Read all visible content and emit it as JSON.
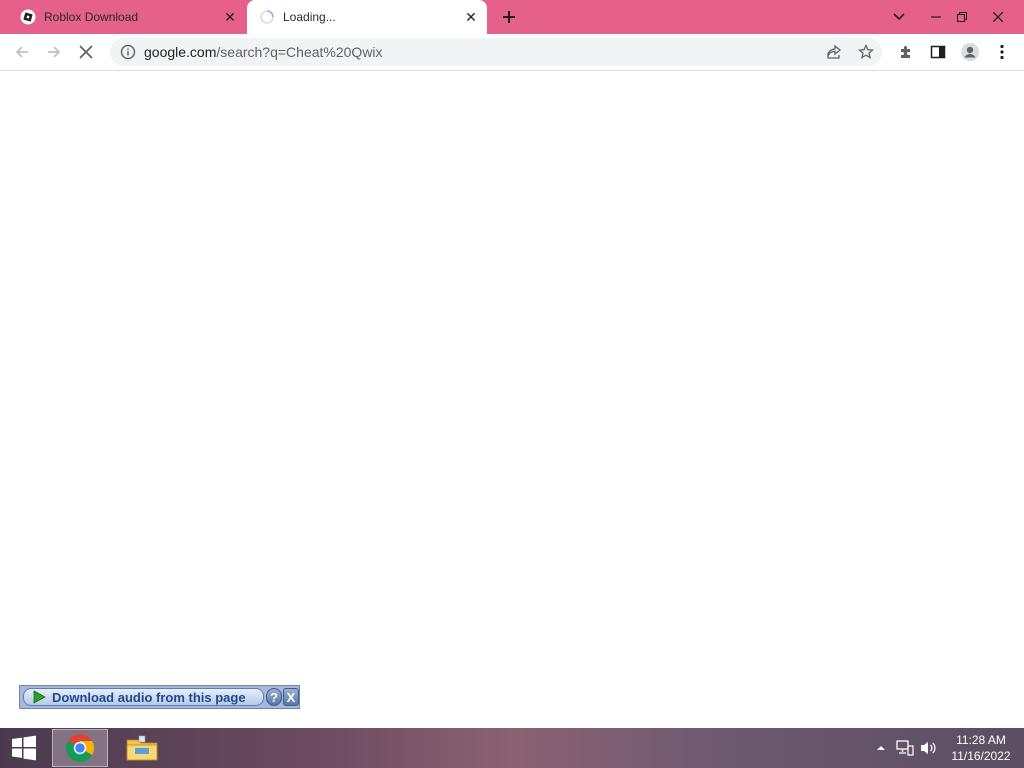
{
  "browser": {
    "tabs": [
      {
        "title": "Roblox Download",
        "favicon": "roblox-icon",
        "active": false
      },
      {
        "title": "Loading...",
        "favicon": "loading-spinner-icon",
        "active": true
      }
    ],
    "url": {
      "host": "google.com",
      "path": "/search?q=Cheat%20Qwix"
    },
    "icons": {
      "back": "back-arrow-icon",
      "forward": "forward-arrow-icon",
      "stop": "stop-icon",
      "share": "share-icon",
      "bookmark": "star-icon",
      "extensions": "puzzle-icon",
      "side_panel": "side-panel-icon",
      "profile": "profile-icon",
      "menu": "kebab-menu-icon"
    },
    "colors": {
      "tabstrip": "#e5608a",
      "toolbar": "#ffffff"
    }
  },
  "audio_bar": {
    "label": "Download audio from this page",
    "help": "?",
    "close": "X"
  },
  "taskbar": {
    "apps": [
      "chrome-icon",
      "file-explorer-icon"
    ],
    "clock": {
      "time": "11:28 AM",
      "date": "11/16/2022"
    }
  }
}
